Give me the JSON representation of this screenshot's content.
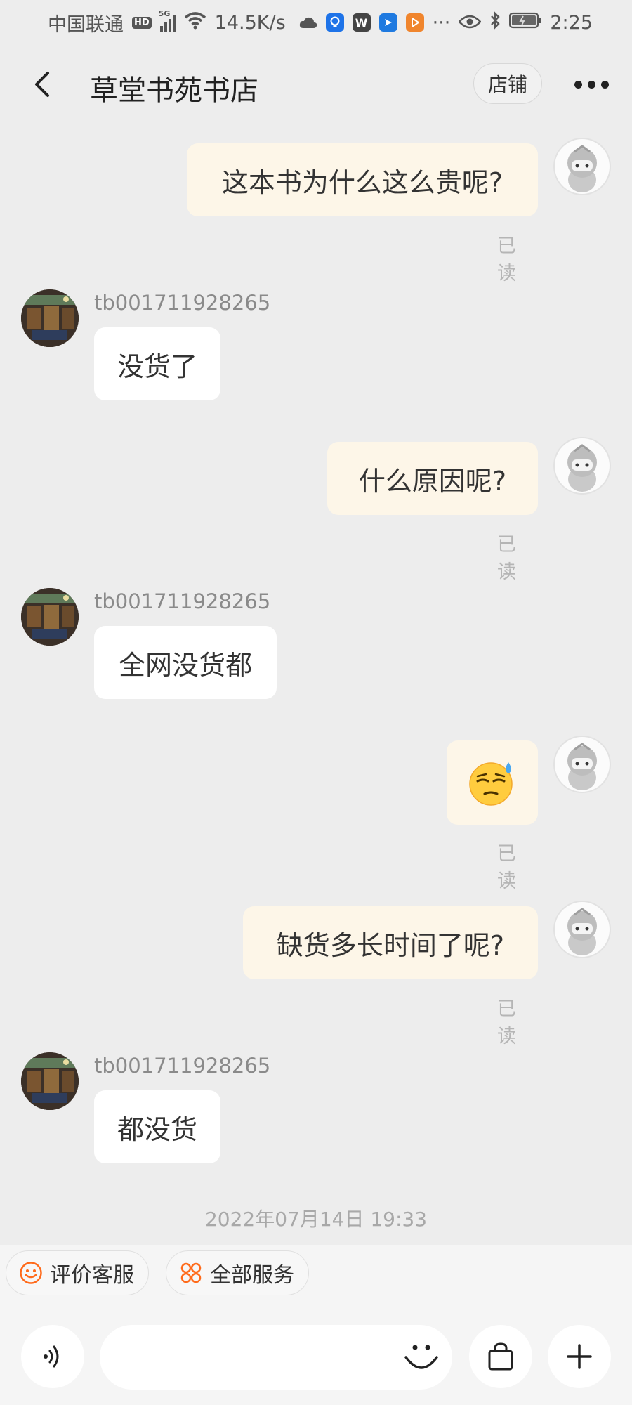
{
  "status_bar": {
    "carrier": "中国联通",
    "hd": "HD",
    "net": "5G",
    "speed": "14.5K/s",
    "more": "···",
    "time": "2:25"
  },
  "header": {
    "title": "草堂书苑书店",
    "shop_button": "店铺"
  },
  "messages": [
    {
      "from": "me",
      "text": "这本书为什么这么贵呢?",
      "status": "已读"
    },
    {
      "from": "shop",
      "sender": "tb001711928265",
      "text": "没货了"
    },
    {
      "from": "me",
      "text": "什么原因呢?",
      "status": "已读"
    },
    {
      "from": "shop",
      "sender": "tb001711928265",
      "text": "全网没货都"
    },
    {
      "from": "me",
      "emoji": "sweat-emoji",
      "status": "已读"
    },
    {
      "from": "me",
      "text": "缺货多长时间了呢?",
      "status": "已读"
    },
    {
      "from": "shop",
      "sender": "tb001711928265",
      "text": "都没货"
    }
  ],
  "timestamp": "2022年07月14日 19:33",
  "services": {
    "rate": "评价客服",
    "all": "全部服务"
  },
  "input": {
    "placeholder": ""
  },
  "colors": {
    "background": "#ededed",
    "my_bubble": "#fdf6e8",
    "shop_bubble": "#ffffff",
    "accent": "#ff6a1a"
  }
}
